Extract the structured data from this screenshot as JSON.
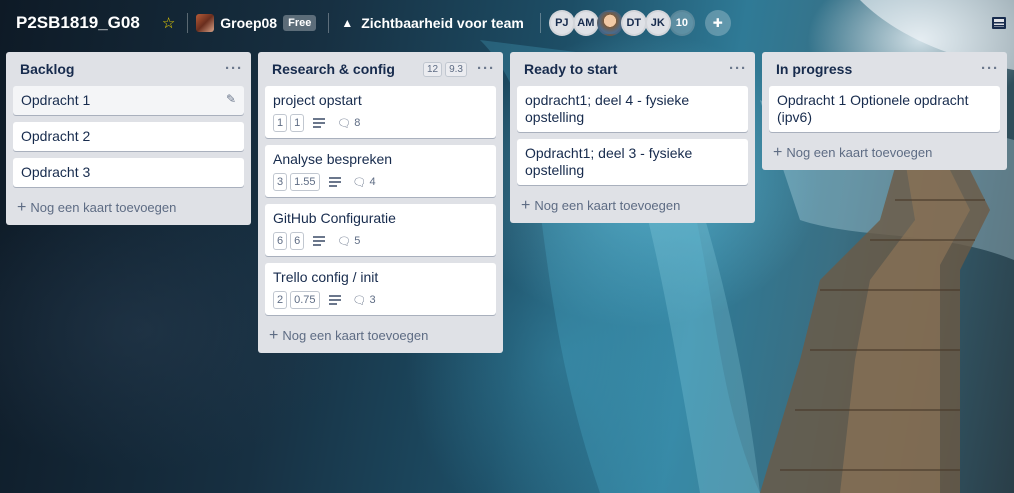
{
  "header": {
    "board_title": "P2SB1819_G08",
    "team_name": "Groep08",
    "team_badge": "Free",
    "visibility": "Zichtbaarheid voor team",
    "members": [
      "PJ",
      "AM",
      "",
      "DT",
      "JK"
    ],
    "member_count": "10"
  },
  "lists": [
    {
      "title": "Backlog",
      "cards": [
        {
          "title": "Opdracht 1"
        },
        {
          "title": "Opdracht 2"
        },
        {
          "title": "Opdracht 3"
        }
      ],
      "add_label": "Nog een kaart toevoegen"
    },
    {
      "title": "Research & config",
      "badges": [
        "12",
        "9.3"
      ],
      "cards": [
        {
          "title": "project opstart",
          "a": "1",
          "b": "1",
          "comments": "8"
        },
        {
          "title": "Analyse bespreken",
          "a": "3",
          "b": "1.55",
          "comments": "4"
        },
        {
          "title": "GitHub Configuratie",
          "a": "6",
          "b": "6",
          "comments": "5"
        },
        {
          "title": "Trello config / init",
          "a": "2",
          "b": "0.75",
          "comments": "3"
        }
      ],
      "add_label": "Nog een kaart toevoegen"
    },
    {
      "title": "Ready to start",
      "cards": [
        {
          "title": "opdracht1; deel 4 - fysieke opstelling"
        },
        {
          "title": "Opdracht1; deel 3 - fysieke opstelling"
        }
      ],
      "add_label": "Nog een kaart toevoegen"
    },
    {
      "title": "In progress",
      "cards": [
        {
          "title": "Opdracht 1 Optionele opdracht (ipv6)"
        }
      ],
      "add_label": "Nog een kaart toevoegen"
    }
  ],
  "colors": {
    "list_bg": "#dfe1e6",
    "card_bg": "#ffffff",
    "text": "#172b4d",
    "star": "#f2d600"
  }
}
